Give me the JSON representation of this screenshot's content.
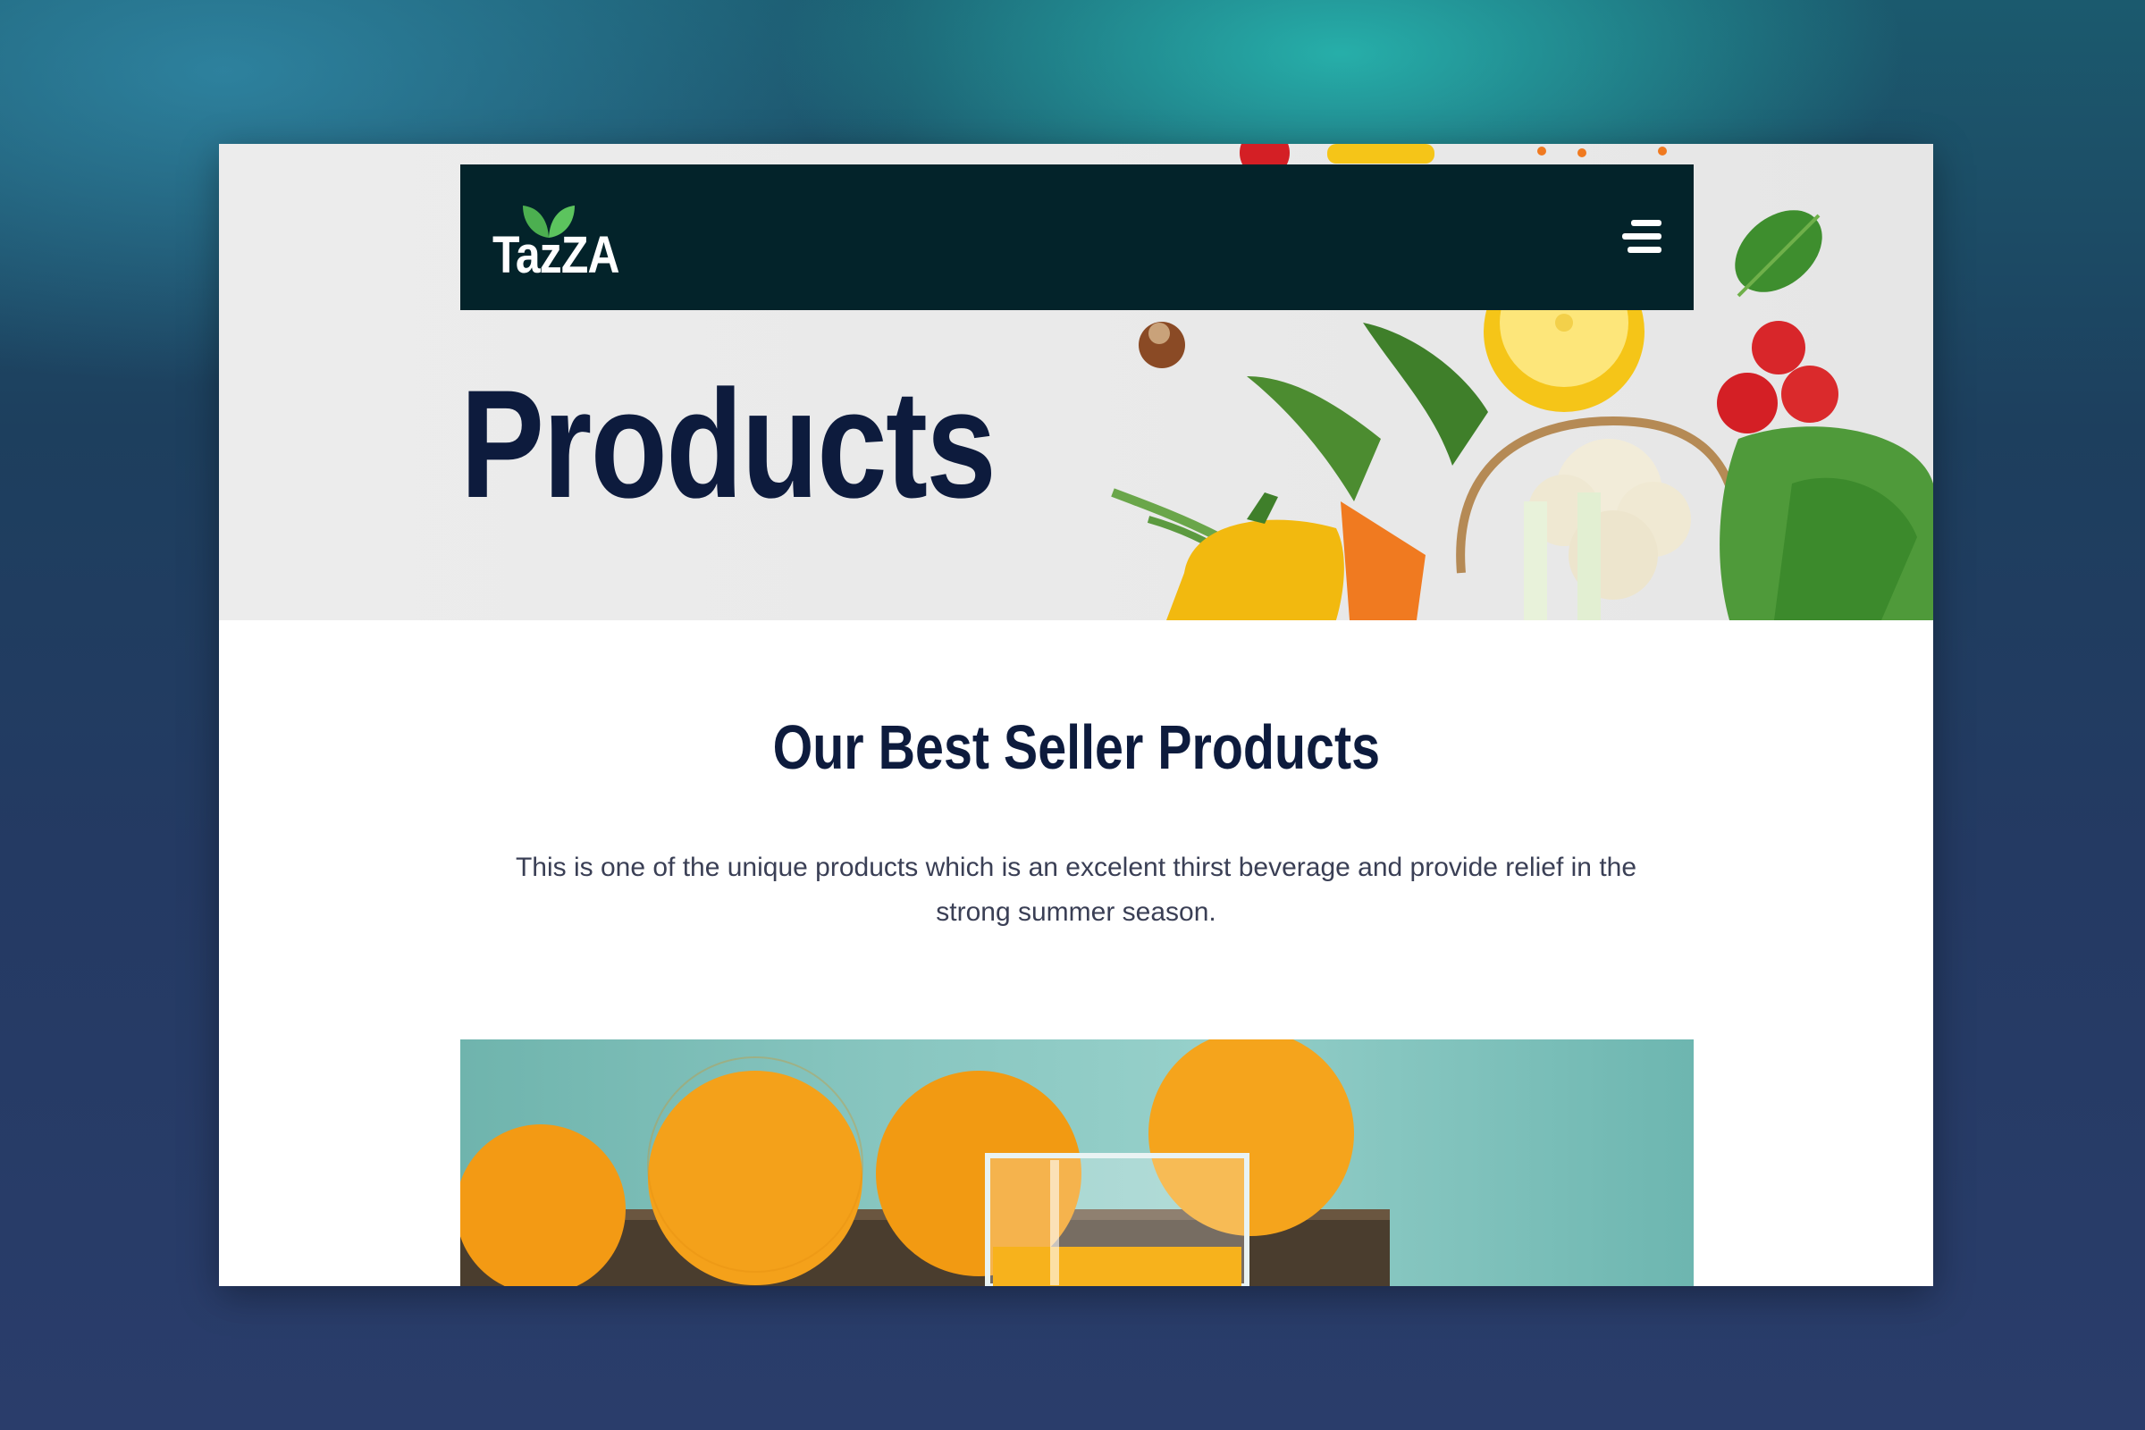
{
  "brand": {
    "name": "TazZA"
  },
  "header": {
    "menu_icon": "hamburger-menu-icon"
  },
  "hero": {
    "title": "Products"
  },
  "section": {
    "title": "Our Best Seller Products",
    "description": "This is one of the unique products which is an excelent thirst beverage and provide relief in the strong summer season."
  },
  "colors": {
    "navbar": "#03232a",
    "heading": "#0d1b3d",
    "body_text": "#3a3f55",
    "logo_leaf": "#4caf50"
  }
}
